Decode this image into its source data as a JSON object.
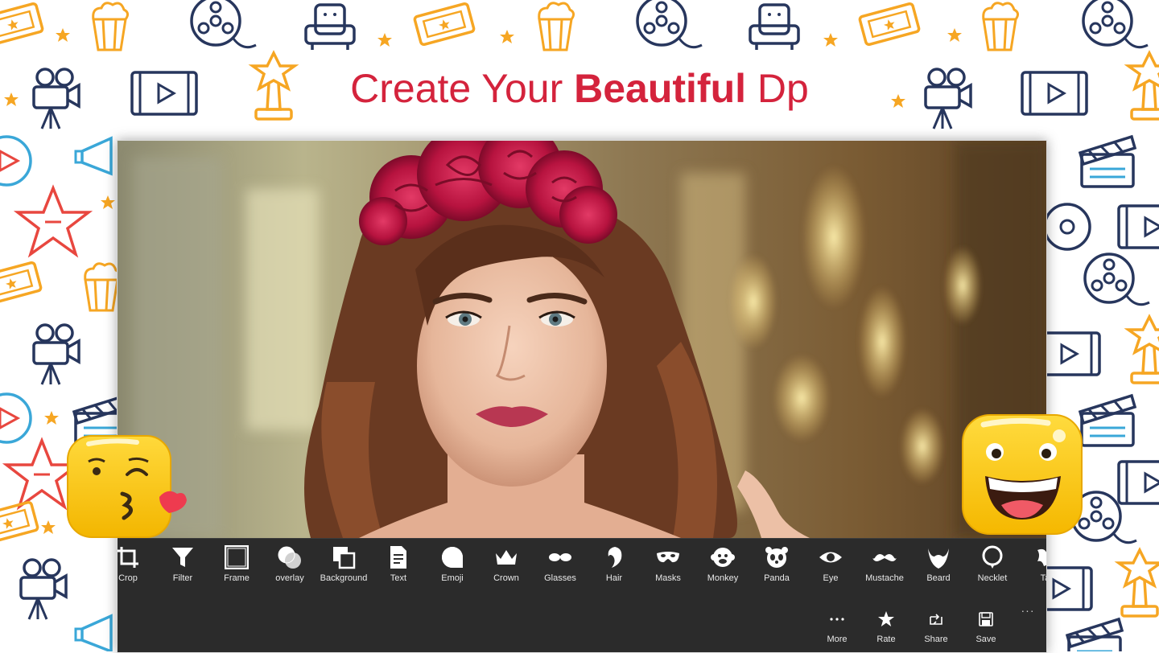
{
  "headline": {
    "part1": "Create Your ",
    "bold": "Beautiful",
    "part2": " Dp"
  },
  "colors": {
    "headline": "#d4233c",
    "toolbar_bg": "#2b2b2b",
    "toolbar_text": "#e8e8e8",
    "doodle_navy": "#27365d",
    "doodle_orange": "#f6a623",
    "doodle_red": "#e8473f",
    "doodle_blue": "#3aa7d8"
  },
  "tools": [
    {
      "label": "Crop",
      "icon": "crop-icon"
    },
    {
      "label": "Filter",
      "icon": "filter-icon"
    },
    {
      "label": "Frame",
      "icon": "frame-icon"
    },
    {
      "label": "overlay",
      "icon": "overlay-icon"
    },
    {
      "label": "Background",
      "icon": "background-icon"
    },
    {
      "label": "Text",
      "icon": "text-icon"
    },
    {
      "label": "Emoji",
      "icon": "emoji-icon"
    },
    {
      "label": "Crown",
      "icon": "crown-icon"
    },
    {
      "label": "Glasses",
      "icon": "glasses-icon"
    },
    {
      "label": "Hair",
      "icon": "hair-icon"
    },
    {
      "label": "Masks",
      "icon": "mask-icon"
    },
    {
      "label": "Monkey",
      "icon": "monkey-icon"
    },
    {
      "label": "Panda",
      "icon": "panda-icon"
    },
    {
      "label": "Eye",
      "icon": "eye-icon"
    },
    {
      "label": "Mustache",
      "icon": "mustache-icon"
    },
    {
      "label": "Beard",
      "icon": "beard-icon"
    },
    {
      "label": "Necklet",
      "icon": "necklet-icon"
    },
    {
      "label": "Tat",
      "icon": "tattoo-icon"
    }
  ],
  "app_bar": {
    "more": {
      "label": "More",
      "icon": "ellipsis-icon"
    },
    "rate": {
      "label": "Rate",
      "icon": "star-icon"
    },
    "share": {
      "label": "Share",
      "icon": "share-icon"
    },
    "save": {
      "label": "Save",
      "icon": "save-icon"
    },
    "overflow": "···"
  }
}
